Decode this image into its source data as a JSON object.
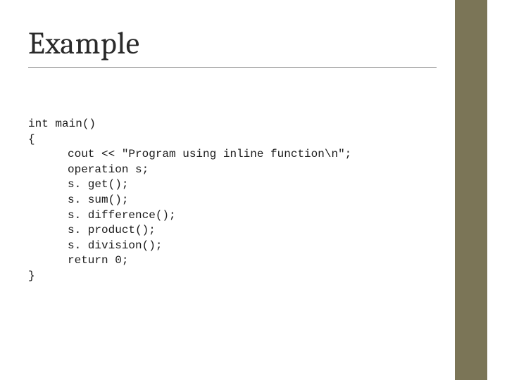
{
  "title": "Example",
  "code": {
    "l1": "int main()",
    "l2": "{",
    "l3": "cout << \"Program using inline function\\n\";",
    "l4": "operation s;",
    "l5": "s. get();",
    "l6": "s. sum();",
    "l7": "s. difference();",
    "l8": "s. product();",
    "l9": "s. division();",
    "l10": "return 0;",
    "l11": "}"
  }
}
